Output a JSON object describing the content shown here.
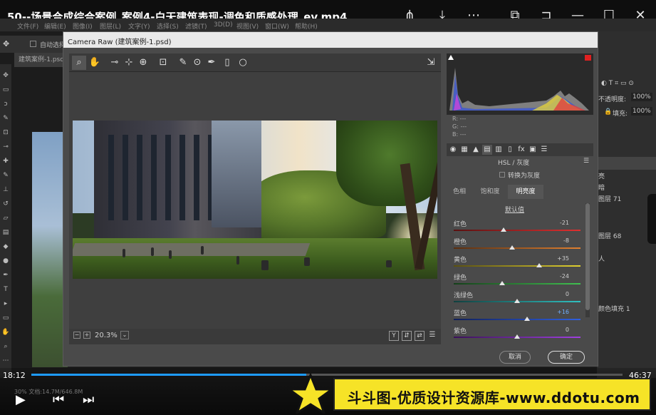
{
  "video": {
    "title": "50--场景合成综合案例_案例4-白天建筑表现-调色和质感处理_ev.mp4",
    "time_current": "18:12",
    "time_total": "46:37",
    "progress_percent": 46.5
  },
  "watermark": {
    "text": "斗斗图-优质设计资源库-www.ddotu.com"
  },
  "ps": {
    "menu": [
      "文件(F)",
      "编辑(E)",
      "图像(I)",
      "图层(L)",
      "文字(Y)",
      "选择(S)",
      "滤镜(T)",
      "3D(D)",
      "视图(V)",
      "窗口(W)",
      "帮助(H)"
    ],
    "auto_select": "自动选择",
    "doc_tab": "建筑案例-1.psd",
    "status": "30%    文档:14.7M/646.8M",
    "right_panel": {
      "opacity_label": "不透明度:",
      "opacity_value": "100%",
      "fill_label": "填充:",
      "fill_value": "100%",
      "items": [
        "亮",
        "暗",
        "图层 71",
        "图层 68",
        "人",
        "颜色填充 1"
      ]
    }
  },
  "camera_raw": {
    "title": "Camera Raw (建筑案例-1.psd)",
    "zoom": "20.3%",
    "rgb": {
      "r": "R: ---",
      "g": "G: ---",
      "b": "B: ---"
    },
    "panel_name": "HSL / 灰度",
    "grayscale_label": "转换为灰度",
    "tabs": [
      "色相",
      "饱和度",
      "明亮度"
    ],
    "active_tab": 2,
    "default_label": "默认值",
    "sliders": [
      {
        "name": "红色",
        "value": "-21",
        "pos": -21,
        "colors": [
          "#5a1010",
          "#e03030"
        ]
      },
      {
        "name": "橙色",
        "value": "-8",
        "pos": -8,
        "colors": [
          "#5a2e10",
          "#e08030"
        ]
      },
      {
        "name": "黄色",
        "value": "+35",
        "pos": 35,
        "colors": [
          "#5a5010",
          "#e0d030"
        ]
      },
      {
        "name": "绿色",
        "value": "-24",
        "pos": -24,
        "colors": [
          "#15401a",
          "#40c050"
        ]
      },
      {
        "name": "浅绿色",
        "value": "0",
        "pos": 0,
        "colors": [
          "#10403f",
          "#30c0c0"
        ]
      },
      {
        "name": "蓝色",
        "value": "+16",
        "pos": 16,
        "colors": [
          "#101f5a",
          "#3060e0"
        ]
      },
      {
        "name": "紫色",
        "value": "0",
        "pos": 0,
        "colors": [
          "#3a105a",
          "#a040e0"
        ]
      }
    ],
    "buttons": {
      "cancel": "取消",
      "ok": "确定"
    }
  }
}
